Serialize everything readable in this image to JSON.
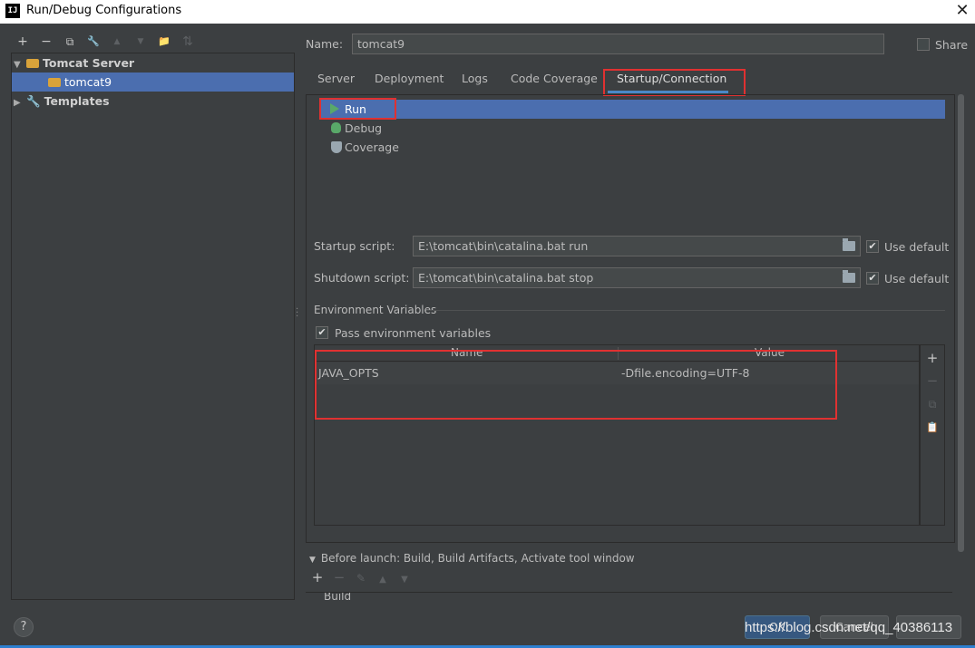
{
  "window": {
    "title": "Run/Debug Configurations",
    "app_icon_text": "IJ",
    "close_glyph": "✕"
  },
  "left_toolbar": {
    "add": "+",
    "remove": "−",
    "copy": "⧉",
    "settings": "🔧",
    "move_up": "▲",
    "move_down": "▼",
    "folder": "📁",
    "sort": "⇅"
  },
  "tree": {
    "items": [
      {
        "label": "Tomcat Server",
        "arrow": "▼",
        "icon": "tomcat-icon"
      },
      {
        "label": "tomcat9",
        "icon": "tomcat-icon",
        "selected": true
      },
      {
        "label": "Templates",
        "arrow": "▶",
        "icon": "wrench-icon"
      }
    ]
  },
  "name_field": {
    "label": "Name:",
    "value": "tomcat9"
  },
  "share": {
    "label": "Share",
    "checked": false
  },
  "tabs": [
    {
      "label": "Server"
    },
    {
      "label": "Deployment"
    },
    {
      "label": "Logs"
    },
    {
      "label": "Code Coverage"
    },
    {
      "label": "Startup/Connection",
      "active": true
    }
  ],
  "modes": [
    {
      "label": "Run",
      "icon": "run-icon",
      "selected": true
    },
    {
      "label": "Debug",
      "icon": "debug-icon"
    },
    {
      "label": "Coverage",
      "icon": "coverage-icon"
    }
  ],
  "startup": {
    "label": "Startup script:",
    "value": "E:\\tomcat\\bin\\catalina.bat run",
    "use_default_label": "Use default",
    "use_default": true
  },
  "shutdown": {
    "label": "Shutdown script:",
    "value": "E:\\tomcat\\bin\\catalina.bat stop",
    "use_default_label": "Use default",
    "use_default": true
  },
  "env": {
    "section_title": "Environment Variables",
    "pass_label": "Pass environment variables",
    "pass_checked": true,
    "columns": [
      "Name",
      "Value"
    ],
    "rows": [
      {
        "name": "JAVA_OPTS",
        "value": "-Dfile.encoding=UTF-8"
      }
    ],
    "side_buttons": {
      "add": "+",
      "remove": "−",
      "copy": "⧉",
      "paste": "📋"
    }
  },
  "before_launch": {
    "title": "Before launch: Build, Build Artifacts, Activate tool window",
    "toolbar": {
      "add": "+",
      "remove": "−",
      "edit": "✎",
      "up": "▲",
      "down": "▼"
    },
    "item": "Build"
  },
  "footer": {
    "help": "?",
    "ok": "OK",
    "cancel": "Cancel",
    "watermark": "https://blog.csdn.net/qq_40386113"
  },
  "colors": {
    "background": "#3c3f41",
    "selection": "#4b6eaf",
    "highlight_red": "#e03131",
    "tab_underline": "#4a88c7",
    "run_green": "#59a869"
  }
}
